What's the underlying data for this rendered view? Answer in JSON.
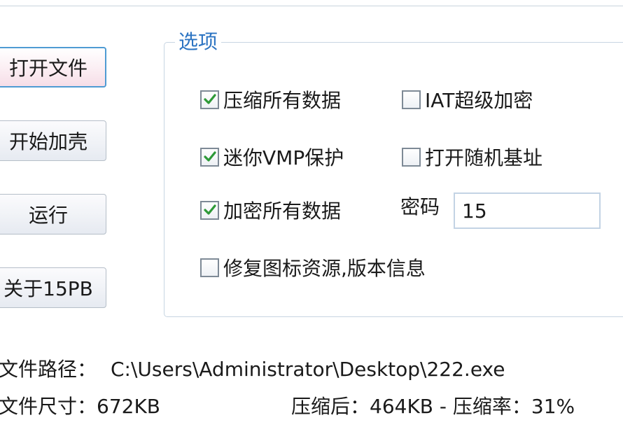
{
  "buttons": {
    "open_file": "打开文件",
    "start_pack": "开始加壳",
    "run": "运行",
    "about": "关于15PB"
  },
  "options": {
    "title": "选项",
    "compress_all": {
      "label": "压缩所有数据",
      "checked": true
    },
    "iat_encrypt": {
      "label": "IAT超级加密",
      "checked": false
    },
    "mini_vmp": {
      "label": "迷你VMP保护",
      "checked": true
    },
    "random_base": {
      "label": "打开随机基址",
      "checked": false
    },
    "encrypt_all": {
      "label": "加密所有数据",
      "checked": true
    },
    "fix_resources": {
      "label": "修复图标资源,版本信息",
      "checked": false
    },
    "password_label": "密码",
    "password_value": "15"
  },
  "info": {
    "path_label": "文件路径：",
    "path_value": "C:\\Users\\Administrator\\Desktop\\222.exe",
    "size_text": "文件尺寸：672KB",
    "compressed_text": "压缩后：464KB - 压缩率：31%"
  },
  "colors": {
    "group_title": "#2b73c2",
    "checkmark": "#2e9a38",
    "focus_border": "#4f9bd3"
  }
}
